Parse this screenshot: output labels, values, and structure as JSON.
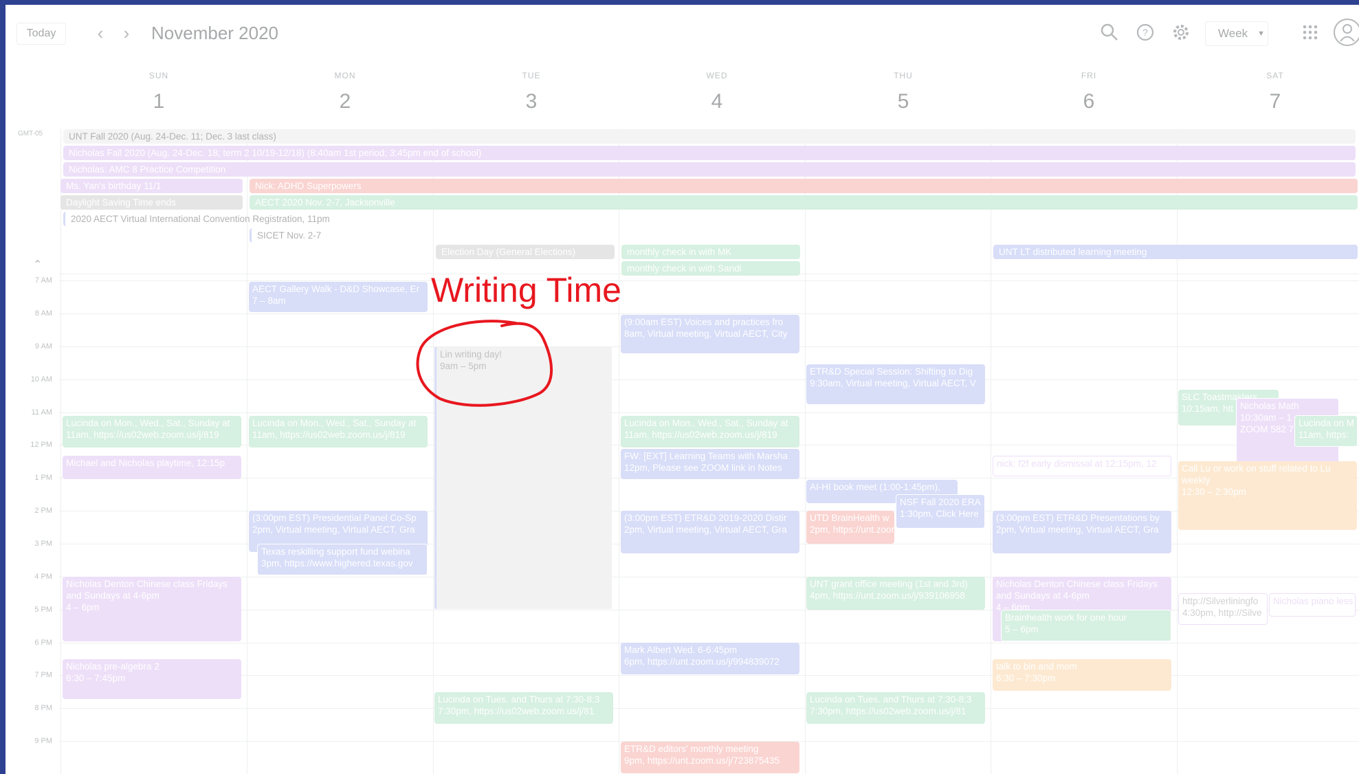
{
  "header": {
    "today_label": "Today",
    "prev_icon": "chevron-left-icon",
    "next_icon": "chevron-right-icon",
    "month_title": "November 2020",
    "view_label": "Week",
    "search_icon": "search-icon",
    "help_icon": "help-icon",
    "settings_icon": "gear-icon",
    "apps_icon": "apps-grid-icon"
  },
  "timezone_label": "GMT-05",
  "days": [
    {
      "dow": "SUN",
      "num": "1"
    },
    {
      "dow": "MON",
      "num": "2"
    },
    {
      "dow": "TUE",
      "num": "3"
    },
    {
      "dow": "WED",
      "num": "4"
    },
    {
      "dow": "THU",
      "num": "5"
    },
    {
      "dow": "FRI",
      "num": "6"
    },
    {
      "dow": "SAT",
      "num": "7"
    }
  ],
  "hours": [
    "7 AM",
    "8 AM",
    "9 AM",
    "10 AM",
    "11 AM",
    "12 PM",
    "1 PM",
    "2 PM",
    "3 PM",
    "4 PM",
    "5 PM",
    "6 PM",
    "7 PM",
    "8 PM",
    "9 PM"
  ],
  "allday": {
    "unt_fall": "UNT Fall 2020 (Aug. 24-Dec. 11; Dec. 3 last class)",
    "nicholas_fall": "Nicholas Fall 2020 (Aug. 24-Dec. 18; term 2 10/19-12/18) (8:40am 1st period; 3:45pm end of school)",
    "amc8": "Nicholas: AMC 8 Practice Competition",
    "ms_yan": "Ms. Yan's birthday 11/1",
    "nick_adhd": "Nick: ADHD Superpowers",
    "daylight": "Daylight Saving Time ends",
    "aect_nov": "AECT 2020 Nov. 2-7, Jacksonville",
    "aect_reg": "2020 AECT Virtual International Convention Registration, 11pm",
    "sicet": "SICET Nov. 2-7",
    "election": "Election Day (General Elections)",
    "checkin_mk": "monthly check in with MK",
    "checkin_sandi": "monthly check in with Sandi",
    "unt_lt": "UNT LT distributed learning meeting"
  },
  "events": {
    "aect_gallery_title": "AECT Gallery Walk - D&D Showcase, Er",
    "aect_gallery_time": "7 – 8am",
    "lin_title": "Lin writing day!",
    "lin_time": "9am – 5pm",
    "voices_title": "(9:00am EST) Voices and practices fro",
    "voices_time": "8am, Virtual meeting, Virtual AECT, City",
    "etrd_special_title": "ETR&D Special Session: Shifting to Dig",
    "etrd_special_time": "9:30am, Virtual meeting, Virtual AECT, V",
    "slc_title": "SLC Toastmasters",
    "slc_time": "10:15am, htt",
    "nm_math_title": "Nicholas Math",
    "nm_math_time": "10:30am – 1",
    "nm_math_zoom": "ZOOM 582 7",
    "lucinda_sun_title": "Lucinda on Mon., Wed., Sat., Sunday at",
    "lucinda_sun_time": "11am, https://us02web.zoom.us/j/819",
    "lucinda_mon_title": "Lucinda on Mon., Wed., Sat., Sunday at",
    "lucinda_mon_time": "11am, https://us02web.zoom.us/j/819",
    "lucinda_wed_title": "Lucinda on Mon., Wed., Sat., Sunday at",
    "lucinda_wed_time": "11am, https://us02web.zoom.us/j/819",
    "lucinda_sat_title": "Lucinda on M",
    "lucinda_sat_time": "11am, https:",
    "michael_title": "Michael and Nicholas playtime, 12:15p",
    "fw_title": "FW: [EXT] Learning Teams with Marsha",
    "fw_time": "12pm, Please see ZOOM link in Notes",
    "nick_f2f": "nick: f2f early dismissal at 12:15pm, 12",
    "call_lu_title": "Call Lu or work on stuff related to Lu weekly",
    "call_lu_time": "12:30 – 2:30pm",
    "aihi_title": "AI-HI book meet (1:00-1:45pm),",
    "nsf_title": "NSF Fall 2020 ERA",
    "nsf_time": "1:30pm, Click Here",
    "pres_panel_title": "(3:00pm EST) Presidential Panel Co-Sp",
    "pres_panel_time": "2pm, Virtual meeting, Virtual AECT, Gra",
    "etrd_2019_title": "(3:00pm EST) ETR&D 2019-2020 Distir",
    "etrd_2019_time": "2pm, Virtual meeting, Virtual AECT, Gra",
    "utd_title": "UTD BrainHealth w",
    "utd_time": "2pm, https://unt.zoom.us/s/7238",
    "etrd_pres_title": "(3:00pm EST) ETR&D Presentations by",
    "etrd_pres_time": "2pm, Virtual meeting, Virtual AECT, Gra",
    "texas_title": "Texas reskilling support fund webina",
    "texas_time": "3pm, https://www.highered.texas.gov",
    "chinese_sun_title": "Nicholas Denton Chinese class Fridays and Sundays at 4-6pm",
    "chinese_sun_time": "4 – 6pm",
    "unt_grant_title": "UNT grant office meeting (1st and 3rd)",
    "unt_grant_time": "4pm, https://unt.zoom.us/j/939106958",
    "chinese_fri_title": "Nicholas Denton Chinese class Fridays and Sundays at 4-6pm",
    "chinese_fri_time": "4 – 6pm",
    "brainhealth_title": "Brainhealth work for one hour",
    "brainhealth_time": "5 – 6pm",
    "silverlining_title": "http://Silverliningfo",
    "silverlining_time": "4:30pm, http://Silve",
    "piano_title": "Nicholas piano less",
    "mark_title": "Mark Albert Wed. 6-6:45pm",
    "mark_time": "6pm, https://unt.zoom.us/j/994839072",
    "prealg_title": "Nicholas pre-algebra 2",
    "prealg_time": "6:30 – 7:45pm",
    "talk_title": "talk to bin and mom",
    "talk_time": "6:30 – 7:30pm",
    "lucinda_tue_title": "Lucinda on Tues. and Thurs at 7:30-8:3",
    "lucinda_tue_time": "7:30pm, https://us02web.zoom.us/j/81",
    "lucinda_thu_title": "Lucinda on Tues. and Thurs at 7:30-8:3",
    "lucinda_thu_time": "7:30pm, https://us02web.zoom.us/j/81",
    "etrd_editors_title": "ETR&D editors' monthly meeting",
    "etrd_editors_time": "9pm, https://unt.zoom.us/j/723875435"
  },
  "annotation": {
    "label": "Writing Time",
    "color": "#e8171f"
  },
  "colors": {
    "blue": "#a9b6f1",
    "green": "#a6dfbe",
    "purple": "#d9b9f1",
    "red": "#f6a19a",
    "orange": "#fbcf9b",
    "grey": "#c7c7c7",
    "lin_event": "#e4e4e4"
  }
}
